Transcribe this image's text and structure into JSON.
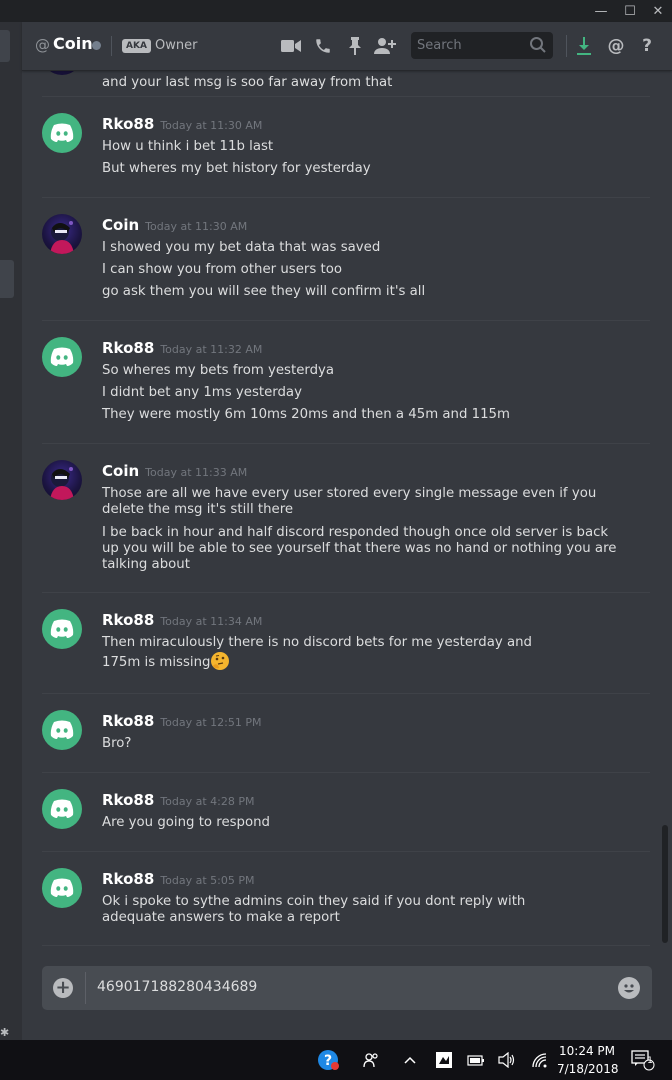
{
  "window": {
    "minimize": "—",
    "maximize": "☐",
    "close": "✕"
  },
  "header": {
    "at": "@",
    "channel_name": "Coin",
    "aka_badge": "AKA",
    "nickname": "Owner",
    "search_placeholder": "Search",
    "icons": [
      "video-call-icon",
      "voice-call-icon",
      "pin-icon",
      "add-friend-icon",
      "search-icon",
      "download-icon",
      "mention-icon",
      "help-icon"
    ]
  },
  "messages": [
    {
      "author": "",
      "timestamp": "",
      "lines": [
        "and your last msg is soo far away from that"
      ]
    },
    {
      "author": "Rko88",
      "timestamp": "Today at 11:30 AM",
      "lines": [
        "How u think i bet 11b last",
        "But wheres my bet history for yesterday"
      ]
    },
    {
      "author": "Coin",
      "timestamp": "Today at 11:30 AM",
      "lines": [
        "I showed you my bet data that was saved",
        "I can show you from other users too",
        "go ask them you will see they will confirm it's all"
      ]
    },
    {
      "author": "Rko88",
      "timestamp": "Today at 11:32 AM",
      "lines": [
        "So wheres my bets from yesterdya",
        "I didnt bet any 1ms yesterday",
        "They were mostly 6m 10ms 20ms and then a 45m and  115m"
      ]
    },
    {
      "author": "Coin",
      "timestamp": "Today at 11:33 AM",
      "lines": [
        "Those are all we have every user stored every single message even if you delete the msg it's still there",
        "I be back in hour and half discord responded though once old server is back up you will be able to see yourself that there was no hand or nothing you are talking about"
      ]
    },
    {
      "author": "Rko88",
      "timestamp": "Today at 11:34 AM",
      "lines": [
        "Then miraculously there is no discord bets for me yesterday and 175m is missing"
      ]
    },
    {
      "author": "Rko88",
      "timestamp": "Today at 12:51 PM",
      "lines": [
        "Bro?"
      ]
    },
    {
      "author": "Rko88",
      "timestamp": "Today at 4:28 PM",
      "lines": [
        "Are you going to respond"
      ]
    },
    {
      "author": "Rko88",
      "timestamp": "Today at 5:05 PM",
      "lines": [
        "Ok i spoke to sythe admins coin they said if you dont reply with adequate answers to make a report"
      ]
    }
  ],
  "composer": {
    "value": "469017188280434689"
  },
  "taskbar": {
    "time": "10:24 PM",
    "date": "7/18/2018",
    "notification_count": "1",
    "icons": [
      "help-tray-icon",
      "people-icon",
      "chevron-up-icon",
      "app-tray-icon",
      "battery-icon",
      "volume-icon",
      "wifi-icon",
      "action-center-icon"
    ]
  }
}
